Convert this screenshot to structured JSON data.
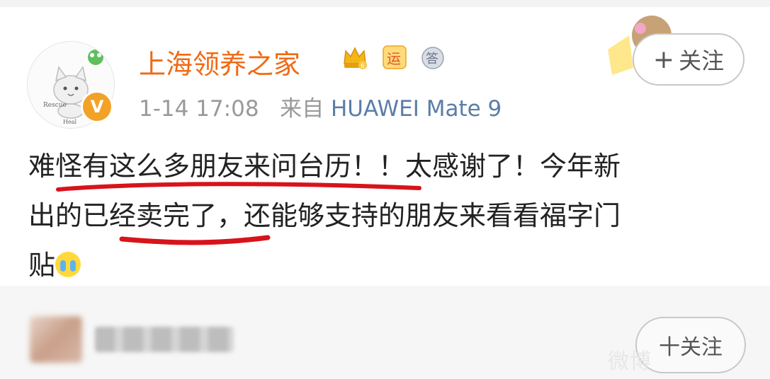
{
  "user": {
    "name": "上海领养之家",
    "timestamp": "1-14 17:08",
    "source_prefix": "来自",
    "device": "HUAWEI Mate 9",
    "avatar_text": [
      "上海领养之家",
      "Rescue",
      "Heal"
    ],
    "badges": [
      "crown-badge-icon",
      "yun-badge-icon",
      "answer-badge-icon"
    ],
    "badge_labels": {
      "yun": "运",
      "answer": "答"
    }
  },
  "follow": {
    "plus": "+",
    "label": "关注"
  },
  "post": {
    "lines": [
      "难怪有这么多朋友来问台历！！太感谢了！今年新",
      "出的已经卖完了，还能够支持的朋友来看看福字门",
      "贴"
    ],
    "emoji": "crying-face-icon"
  },
  "second_follow": {
    "label": "十关注"
  },
  "watermark": "微博"
}
